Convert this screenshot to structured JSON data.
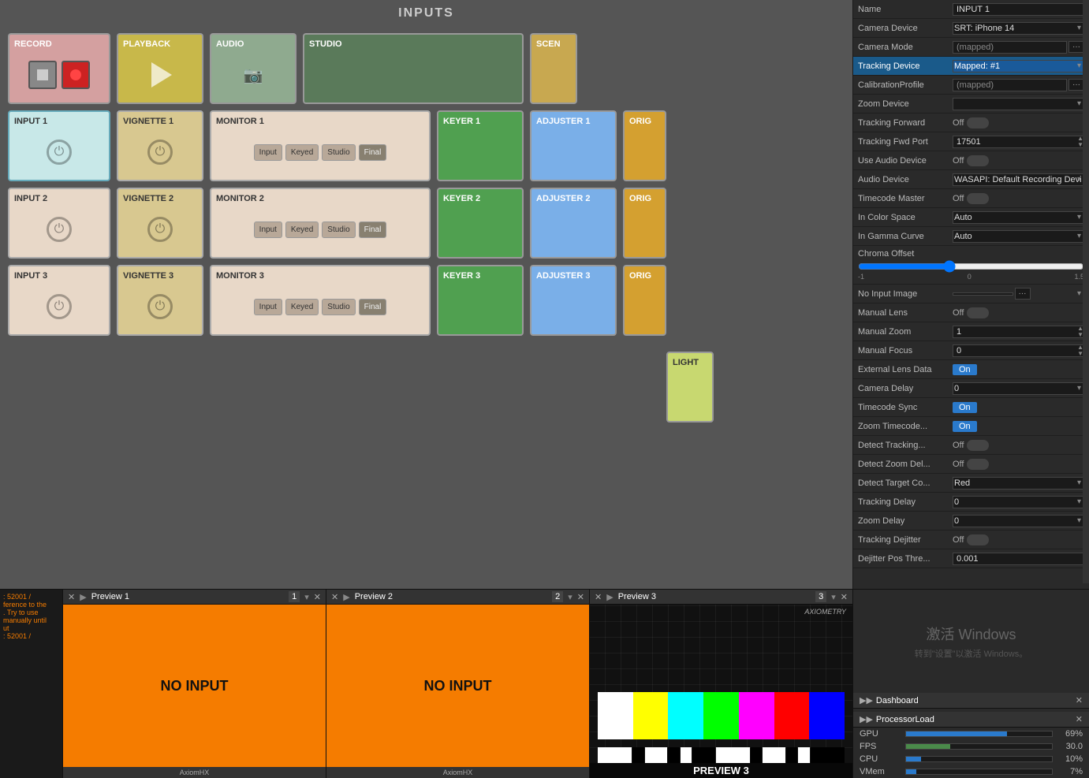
{
  "header": {
    "title": "INPUTS"
  },
  "tiles": {
    "row0": [
      {
        "id": "record",
        "label": "RECORD",
        "type": "record"
      },
      {
        "id": "playback",
        "label": "PLAYBACK",
        "type": "playback"
      },
      {
        "id": "audio",
        "label": "AUDIO",
        "type": "audio"
      },
      {
        "id": "studio",
        "label": "STUDIO",
        "type": "studio"
      },
      {
        "id": "scene",
        "label": "SCENE",
        "type": "scene"
      }
    ],
    "row1": [
      {
        "id": "input1",
        "label": "INPUT 1",
        "type": "input-selected"
      },
      {
        "id": "vignette1",
        "label": "VIGNETTE 1",
        "type": "vignette"
      },
      {
        "id": "monitor1",
        "label": "MONITOR 1",
        "type": "monitor"
      },
      {
        "id": "keyer1",
        "label": "KEYER 1",
        "type": "keyer"
      },
      {
        "id": "adjuster1",
        "label": "ADJUSTER 1",
        "type": "adjuster"
      },
      {
        "id": "orig1",
        "label": "ORIG",
        "type": "orig"
      }
    ],
    "row2": [
      {
        "id": "input2",
        "label": "INPUT 2",
        "type": "input"
      },
      {
        "id": "vignette2",
        "label": "VIGNETTE 2",
        "type": "vignette"
      },
      {
        "id": "monitor2",
        "label": "MONITOR 2",
        "type": "monitor"
      },
      {
        "id": "keyer2",
        "label": "KEYER 2",
        "type": "keyer"
      },
      {
        "id": "adjuster2",
        "label": "ADJUSTER 2",
        "type": "adjuster"
      },
      {
        "id": "orig2",
        "label": "ORIG",
        "type": "orig"
      }
    ],
    "row3": [
      {
        "id": "input3",
        "label": "INPUT 3",
        "type": "input"
      },
      {
        "id": "vignette3",
        "label": "VIGNETTE 3",
        "type": "vignette"
      },
      {
        "id": "monitor3",
        "label": "MONITOR 3",
        "type": "monitor"
      },
      {
        "id": "keyer3",
        "label": "KEYER 3",
        "type": "keyer"
      },
      {
        "id": "adjuster3",
        "label": "ADJUSTER 3",
        "type": "adjuster"
      },
      {
        "id": "orig3",
        "label": "ORIG",
        "type": "orig"
      }
    ],
    "row4": [
      {
        "id": "light",
        "label": "LIGHT",
        "type": "light"
      }
    ]
  },
  "monitor_btns": [
    "Input",
    "Keyed",
    "Studio",
    "Final"
  ],
  "right_panel": {
    "name_label": "Name",
    "name_value": "INPUT 1",
    "rows": [
      {
        "label": "Camera Device",
        "type": "select",
        "value": "SRT: iPhone 14"
      },
      {
        "label": "Camera Mode",
        "type": "select-mapped",
        "value": "(mapped)"
      },
      {
        "label": "Tracking Device",
        "type": "select-highlight",
        "value": "Mapped: #1",
        "highlighted": true
      },
      {
        "label": "CalibrationProfile",
        "type": "select-mapped",
        "value": "(mapped)"
      },
      {
        "label": "Zoom Device",
        "type": "select",
        "value": ""
      },
      {
        "label": "Tracking Forward",
        "type": "toggle",
        "value": "Off"
      },
      {
        "label": "Tracking Fwd Port",
        "type": "port",
        "value": "17501"
      },
      {
        "label": "Use Audio Device",
        "type": "toggle",
        "value": "Off"
      },
      {
        "label": "Audio Device",
        "type": "select",
        "value": "WASAPI: Default Recording Devi"
      },
      {
        "label": "Timecode Master",
        "type": "toggle",
        "value": "Off"
      },
      {
        "label": "In Color Space",
        "type": "select",
        "value": "Auto"
      },
      {
        "label": "In Gamma Curve",
        "type": "select",
        "value": "Auto"
      },
      {
        "label": "Chroma Offset",
        "type": "slider",
        "value": "0",
        "min": "-1",
        "max": "1.5"
      },
      {
        "label": "No Input Image",
        "type": "image-select",
        "value": ""
      },
      {
        "label": "Manual Lens",
        "type": "toggle",
        "value": "Off"
      },
      {
        "label": "Manual Zoom",
        "type": "number",
        "value": "1"
      },
      {
        "label": "Manual Focus",
        "type": "number",
        "value": "0"
      },
      {
        "label": "External Lens Data",
        "type": "on-btn",
        "value": "On"
      },
      {
        "label": "Camera Delay",
        "type": "select-num",
        "value": "0"
      },
      {
        "label": "Timecode Sync",
        "type": "on-btn",
        "value": "On"
      },
      {
        "label": "Zoom Timecode...",
        "type": "on-btn",
        "value": "On"
      },
      {
        "label": "Detect Tracking...",
        "type": "toggle",
        "value": "Off"
      },
      {
        "label": "Detect Zoom Del...",
        "type": "toggle",
        "value": "Off"
      },
      {
        "label": "Detect Target Co...",
        "type": "select",
        "value": "Red"
      },
      {
        "label": "Tracking Delay",
        "type": "select-num",
        "value": "0"
      },
      {
        "label": "Zoom Delay",
        "type": "select-num",
        "value": "0"
      },
      {
        "label": "Tracking Dejitter",
        "type": "toggle",
        "value": "Off"
      },
      {
        "label": "Dejitter Pos Thre...",
        "type": "number",
        "value": "0.001"
      }
    ]
  },
  "previews": [
    {
      "id": "preview1",
      "label": "Preview 1",
      "num": "1",
      "type": "no-input",
      "text": "NO INPUT"
    },
    {
      "id": "preview2",
      "label": "Preview 2",
      "num": "2",
      "type": "no-input",
      "text": "NO INPUT"
    },
    {
      "id": "preview3",
      "label": "Preview 3",
      "num": "3",
      "type": "test-card",
      "text": "PREVIEW 3"
    }
  ],
  "log_lines": [
    ": 52001 /",
    "ference to the",
    ". Try to use",
    "manually until",
    "ut",
    ": 52001 /"
  ],
  "processor": {
    "header": "ProcessorLoad",
    "rows": [
      {
        "label": "GPU",
        "value": "69%",
        "bar": 69,
        "color": "blue"
      },
      {
        "label": "FPS",
        "value": "30.0",
        "bar": 30,
        "color": "green"
      },
      {
        "label": "CPU",
        "value": "10%",
        "bar": 10,
        "color": "blue"
      },
      {
        "label": "VMem",
        "value": "7%",
        "bar": 7,
        "color": "blue"
      }
    ]
  },
  "dashboard": {
    "label": "Dashboard"
  },
  "colors": {
    "accent": "#2a7acc",
    "on_btn": "#2a7acc",
    "highlight_row": "#1a5a8a"
  }
}
